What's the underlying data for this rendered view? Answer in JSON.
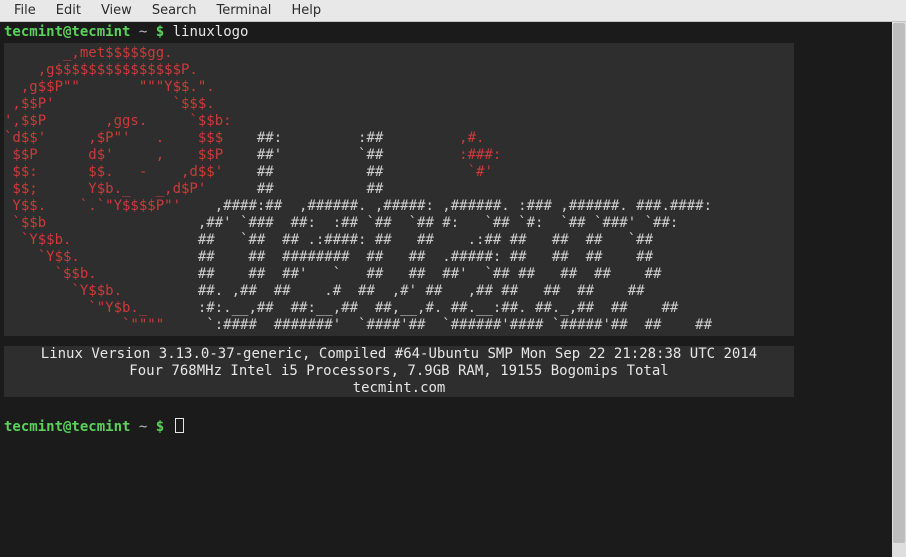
{
  "menubar": {
    "items": [
      "File",
      "Edit",
      "View",
      "Search",
      "Terminal",
      "Help"
    ]
  },
  "prompt": {
    "user_host": "tecmint@tecmint",
    "path": "~",
    "symbol": "$",
    "command": "linuxlogo"
  },
  "ascii": {
    "l01": "       _,met$$$$$gg.",
    "l02": "    ,g$$$$$$$$$$$$$$$P.",
    "l03": "  ,g$$P\"\"       \"\"\"Y$$.\".",
    "l04": " ,$$P'              `$$$.",
    "l05_s": "',$$P       ,ggs.     `$$b:",
    "l06_s": "`d$$'     ,$P\"'   .    $$$",
    "l06_t": "    ##:         :##         ",
    "l06_a": ",#.",
    "l07_s": " $$P      d$'     ,    $$P",
    "l07_t": "    ##'         `##         ",
    "l07_a": ":###:",
    "l08_s": " $$:      $$.   -    ,d$$'",
    "l08_t": "    ##           ##          ",
    "l08_a": "`#'",
    "l09_s": " $$;      Y$b._   _,d$P'",
    "l09_t": "      ##           ##",
    "l10_s": " Y$$.    `.`\"Y$$$$P\"'",
    "l10_t": "    ,####:##  ,######. ,#####: ,######. :### ,######. ###.####:",
    "l11_s": " `$$b",
    "l11_t": "                  ,##' `###  ##:  :## `##  `## #:   `## `#:  `## `###' `##:",
    "l12_s": "  `Y$$b.",
    "l12_t": "               ##   `##  ## .:####: ##   ##    .:## ##   ##  ##   `##",
    "l13_s": "    `Y$$.",
    "l13_t": "              ##    ##  ########  ##   ##  .#####: ##   ##  ##    ##",
    "l14_s": "      `$$b.",
    "l14_t": "            ##    ##  ##'   `   ##   ##  ##'  `## ##   ##  ##    ##",
    "l15_s": "        `Y$$b.",
    "l15_t": "         ##. ,##  ##    .#  ##  ,#' ##   ,## ##   ##  ##    ##",
    "l16_s": "          `\"Y$b._",
    "l16_t": "      :#:.__,##  ##:__,##  ##,__,#. ##.__:##. ##._,##  ##    ##",
    "l17_s": "              `\"\"\"\"",
    "l17_t": "     `:####  #######'  `####'##  `######'#### `#####'##  ##    ##"
  },
  "info": {
    "line1": "Linux Version 3.13.0-37-generic, Compiled #64-Ubuntu SMP Mon Sep 22 21:28:38 UTC 2014",
    "line2": "Four 768MHz Intel i5 Processors, 7.9GB RAM, 19155 Bogomips Total",
    "line3": "tecmint.com"
  }
}
